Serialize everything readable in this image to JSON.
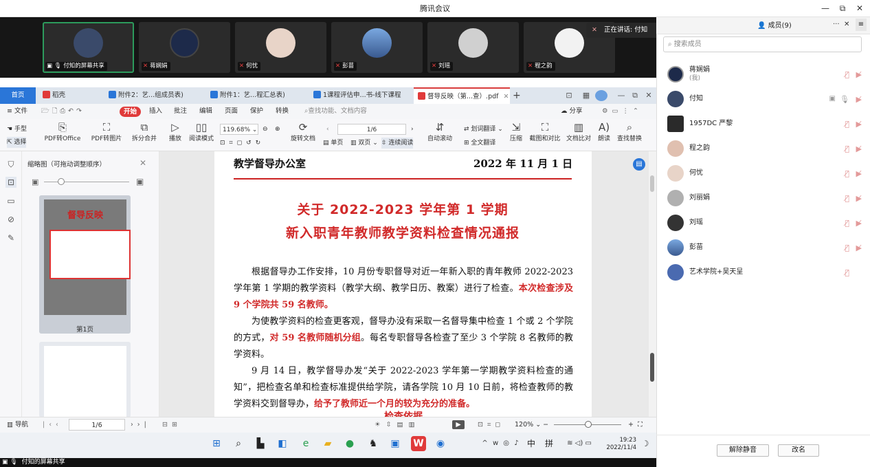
{
  "app": {
    "title": "腾讯会议",
    "minimize": "—",
    "maximize": "⧉",
    "close": "✕"
  },
  "strip": {
    "tiles": [
      {
        "name": "付知的屏幕共享",
        "color": "#3a4a6a"
      },
      {
        "name": "蒋娴娟",
        "color": "#1d2a4a"
      },
      {
        "name": "何忧",
        "color": "#e8d4c8"
      },
      {
        "name": "彭苗",
        "color": "#5a8ac8"
      },
      {
        "name": "刘瑶",
        "color": "#d0d0d0"
      },
      {
        "name": "程之韵",
        "color": "#f2f2f2"
      }
    ],
    "speaking": "正在讲话: 付知"
  },
  "wps": {
    "tabs": [
      {
        "label": "首页",
        "kind": "home"
      },
      {
        "label": "稻壳",
        "color": "#e03a3a"
      },
      {
        "label": "附件2：艺...组成员表)",
        "color": "#2a76d8"
      },
      {
        "label": "附件1：艺...程汇总表)",
        "color": "#2a76d8"
      },
      {
        "label": "1课程评估申...书-线下课程",
        "color": "#2a76d8"
      },
      {
        "label": "督导反映（第...查）.pdf",
        "color": "#e03a3a"
      }
    ],
    "tab_close": "✕",
    "tab_add": "+",
    "menu": {
      "file": "文件",
      "start": "开始",
      "items": [
        "插入",
        "批注",
        "编辑",
        "页面",
        "保护",
        "转换"
      ],
      "search": "查找功能、文档内容",
      "share": "分享"
    },
    "ribbon": {
      "hand": "手型",
      "select": "选择",
      "pdf_office": "PDF转Office",
      "pdf_img": "PDF转图片",
      "split": "拆分合并",
      "play": "播放",
      "read": "阅读模式",
      "zoom": "119.68%",
      "rotate": "旋转文档",
      "page": "1/6",
      "single": "单页",
      "double": "双页",
      "continuous": "连续阅读",
      "autoscroll": "自动滚动",
      "translate_sel": "划词翻译",
      "translate_all": "全文翻译",
      "compress": "压缩",
      "screenshot": "截图和对比",
      "compare": "文档比对",
      "read_aloud": "朗读",
      "find_replace": "查找替换"
    },
    "thumbs": {
      "title": "缩略图（可拖动调整顺序）",
      "page1": "第1页",
      "page1_heading": "督导反映"
    },
    "doc": {
      "org": "教学督导办公室",
      "date": "2022 年 11 月 1 日",
      "title1": "关于 2022-2023 学年第 1 学期",
      "title2": "新入职青年教师教学资料检查情况通报",
      "p1a": "根据督导办工作安排，10 月份专职督导对近一年新入职的青年教师 2022-2023 学年第 1 学期的教学资料（教学大纲、教学日历、教案）进行了检查。",
      "p1b": "本次检查涉及 9 个学院共 59 名教师。",
      "p2a": "为使教学资料的检查更客观，督导办没有采取一名督导集中检查 1 个或 2 个学院的方式，",
      "p2b": "对 59 名教师随机分组",
      "p2c": "。每名专职督导各检查了至少 3 个学院 8 名教师的教学资料。",
      "p3a": "9 月 14 日，教学督导办发“关于 2022-2023 学年第一学期教学资料检查的通知”，把检查名单和检查标准提供给学院，请各学院 10 月 10 日前，将检查教师的教学资料交到督导办，",
      "p3b": "给予了教师近一个月的较为充分的准备。",
      "p4": "检查依据"
    },
    "status": {
      "nav": "导航",
      "page": "1/6",
      "zoom": "120%"
    }
  },
  "taskbar": {
    "time": "19:23",
    "date": "2022/11/4",
    "ime1": "中",
    "ime2": "拼"
  },
  "bottom": {
    "share_label": "付知的屏幕共享"
  },
  "panel": {
    "members_tab": "成员(9)",
    "more": "···",
    "close": "✕",
    "menu": "≡",
    "search_placeholder": "搜索成员",
    "members": [
      {
        "name": "蒋娴娟",
        "sub": "(我)",
        "color": "#1d2a4a"
      },
      {
        "name": "付知",
        "sub": "",
        "color": "#3a4a6a"
      },
      {
        "name": "1957DC 严黎",
        "sub": "",
        "color": "#2a2a2a"
      },
      {
        "name": "程之韵",
        "sub": "",
        "color": "#e0c0b0"
      },
      {
        "name": "何忧",
        "sub": "",
        "color": "#e8d4c8"
      },
      {
        "name": "刘丽娟",
        "sub": "",
        "color": "#b0b0b0"
      },
      {
        "name": "刘瑶",
        "sub": "",
        "color": "#333333"
      },
      {
        "name": "彭苗",
        "sub": "",
        "color": "#5a8ac8"
      },
      {
        "name": "艺术学院+吴天呈",
        "sub": "",
        "color": "#4a6ab0"
      }
    ],
    "unmute_all": "解除静音",
    "rename": "改名"
  }
}
